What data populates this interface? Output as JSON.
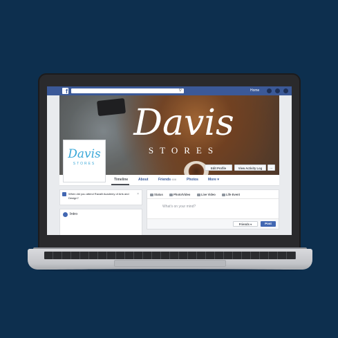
{
  "topbar": {
    "logo": "f",
    "search_placeholder": "",
    "search_icon": "magnifier-icon",
    "home_label": "Home",
    "icons": [
      "friends-icon",
      "messages-icon",
      "globe-icon"
    ]
  },
  "cover": {
    "title": "Davis",
    "subtitle": "STORES",
    "edit_profile": "Edit Profile",
    "view_activity_log": "View Activity Log",
    "more": "···"
  },
  "profile_picture": {
    "title": "Davis",
    "subtitle": "STORES"
  },
  "nav": {
    "tabs": [
      {
        "label": "Timeline"
      },
      {
        "label": "About"
      },
      {
        "label": "Friends",
        "count": "608"
      },
      {
        "label": "Photos"
      },
      {
        "label": "More ▾"
      }
    ]
  },
  "prompt_card": {
    "text": "When did you attend Ravalli Academy of Arts and Design?",
    "close": "×"
  },
  "intro": {
    "label": "Intro"
  },
  "composer": {
    "tabs": [
      {
        "label": "Status"
      },
      {
        "label": "Photo/Video"
      },
      {
        "label": "Live Video"
      },
      {
        "label": "Life Event"
      }
    ],
    "placeholder": "What's on your mind?",
    "audience": "Friends ▾",
    "post": "Post"
  },
  "colors": {
    "background": "#0d2f4e",
    "facebook_blue": "#3b5998",
    "brand_accent": "#3aa8d8"
  }
}
